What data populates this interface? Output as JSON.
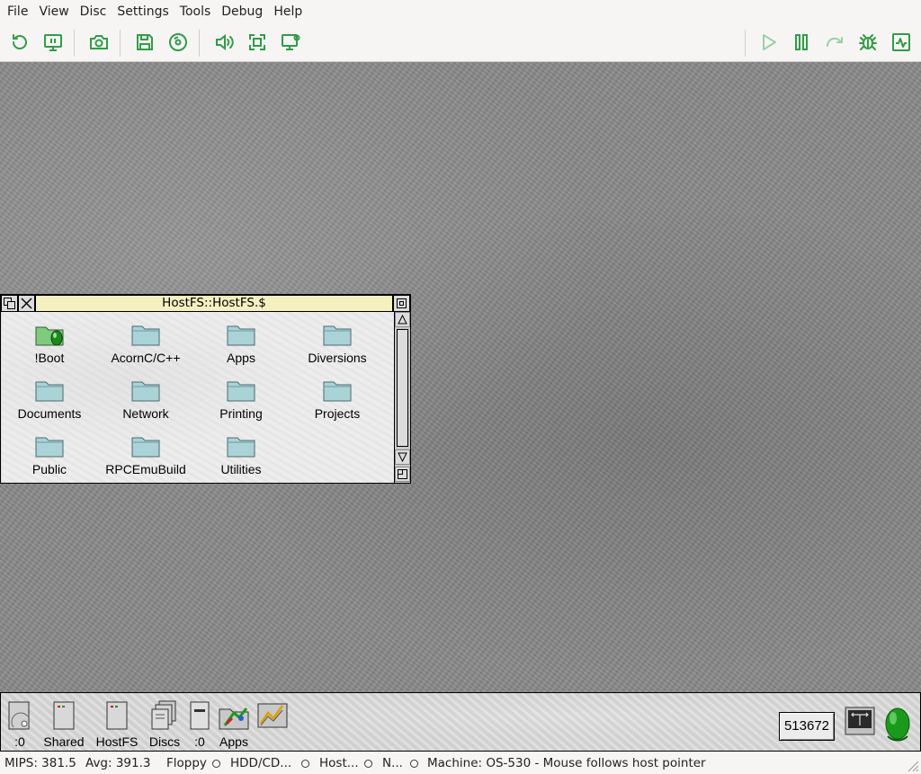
{
  "menubar": {
    "items": [
      "File",
      "View",
      "Disc",
      "Settings",
      "Tools",
      "Debug",
      "Help"
    ]
  },
  "toolbar": {
    "icon_color": "#2e9e44",
    "icon_disabled_color": "#9bd0a6",
    "left_icons": [
      "reset-icon",
      "monitor-icon",
      "screenshot-icon",
      "save-icon",
      "cdrom-icon",
      "sound-icon",
      "fullscreen-icon",
      "display-settings-icon"
    ],
    "right_icons": [
      "play-icon",
      "pause-icon",
      "step-icon",
      "debug-bug-icon",
      "activity-icon"
    ]
  },
  "filer_window": {
    "title": "HostFS::HostFS.$",
    "title_bg": "#f4f0c0",
    "items": [
      {
        "label": "!Boot",
        "type": "application"
      },
      {
        "label": "AcornC/C++",
        "type": "folder"
      },
      {
        "label": "Apps",
        "type": "folder"
      },
      {
        "label": "Diversions",
        "type": "folder"
      },
      {
        "label": "Documents",
        "type": "folder"
      },
      {
        "label": "Network",
        "type": "folder"
      },
      {
        "label": "Printing",
        "type": "folder"
      },
      {
        "label": "Projects",
        "type": "folder"
      },
      {
        "label": "Public",
        "type": "folder"
      },
      {
        "label": "RPCEmuBuild",
        "type": "folder"
      },
      {
        "label": "Utilities",
        "type": "folder"
      }
    ]
  },
  "iconbar": {
    "items": [
      {
        "label": ":0",
        "icon": "floppy-drive-icon"
      },
      {
        "label": "Shared",
        "icon": "shared-drive-icon"
      },
      {
        "label": "HostFS",
        "icon": "hostfs-drive-icon"
      },
      {
        "label": "Discs",
        "icon": "discs-icon"
      },
      {
        "label": ":0",
        "icon": "ram-disc-icon"
      },
      {
        "label": "Apps",
        "icon": "apps-icon"
      },
      {
        "label": "",
        "icon": "chart-app-icon"
      }
    ],
    "free_memory": "513672",
    "right_icons": [
      "display-mode-icon",
      "acorn-icon"
    ]
  },
  "statusbar": {
    "mips": "MIPS: 381.5",
    "avg": "Avg: 391.3",
    "floppy": "Floppy",
    "hdd": "HDD/CD...",
    "host": "Host...",
    "net": "N...",
    "machine": "Machine: OS-530 - Mouse follows host pointer"
  }
}
